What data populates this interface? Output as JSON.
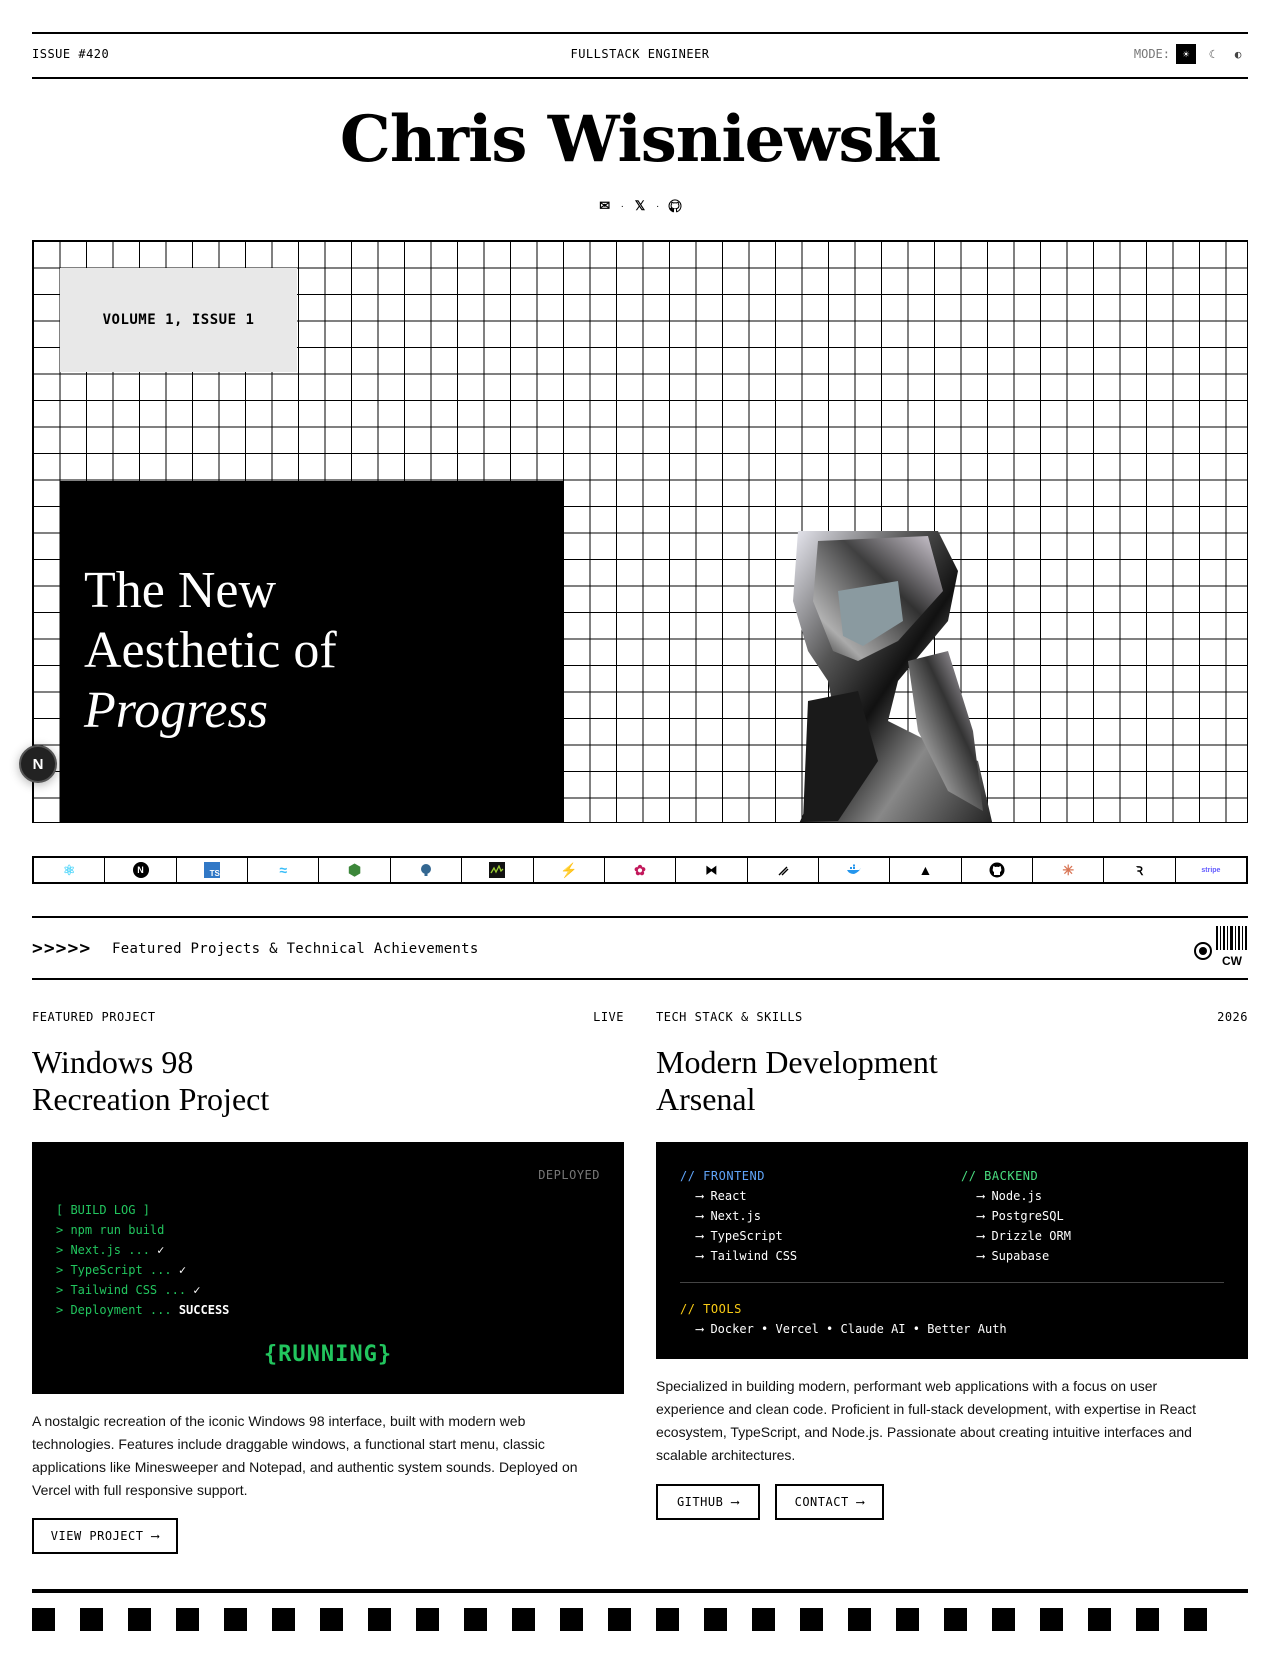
{
  "topbar": {
    "issue": "ISSUE #420",
    "role": "FULLSTACK ENGINEER",
    "mode_label": "MODE:",
    "mode_options": [
      "light",
      "dark",
      "contrast"
    ],
    "mode_active": "light"
  },
  "header": {
    "name": "Chris Wisniewski",
    "social": [
      {
        "icon": "mail-icon",
        "glyph": "✉"
      },
      {
        "icon": "x-icon",
        "glyph": "𝕏"
      },
      {
        "icon": "github-icon",
        "glyph": "⌥"
      }
    ],
    "separator": "·"
  },
  "hero": {
    "volume": "VOLUME 1, ISSUE 1",
    "headline_line1": "The New",
    "headline_line2": "Aesthetic of",
    "headline_line3": "Progress",
    "badge": "N"
  },
  "tech_strip": [
    {
      "name": "react-icon",
      "glyph": "⚛",
      "color": "#61dafb"
    },
    {
      "name": "nextjs-icon",
      "glyph": "N",
      "color": "#000000"
    },
    {
      "name": "typescript-icon",
      "glyph": "TS",
      "color": "#3178c6"
    },
    {
      "name": "tailwind-icon",
      "glyph": "≈",
      "color": "#38bdf8"
    },
    {
      "name": "nodejs-icon",
      "glyph": "⬢",
      "color": "#3c873a"
    },
    {
      "name": "postgresql-icon",
      "glyph": "🐘",
      "color": "#336791"
    },
    {
      "name": "pulse-icon",
      "glyph": "≀",
      "color": "#9acd32"
    },
    {
      "name": "supabase-icon",
      "glyph": "⚡",
      "color": "#3ecf8e"
    },
    {
      "name": "flower-icon",
      "glyph": "✿",
      "color": "#c2185b"
    },
    {
      "name": "hono-icon",
      "glyph": "⧓",
      "color": "#000000"
    },
    {
      "name": "slash-icon",
      "glyph": "⁄⁄",
      "color": "#000000"
    },
    {
      "name": "docker-icon",
      "glyph": "🐳",
      "color": "#2496ed"
    },
    {
      "name": "vercel-icon",
      "glyph": "▲",
      "color": "#000000"
    },
    {
      "name": "github-icon",
      "glyph": "◉",
      "color": "#000000"
    },
    {
      "name": "claude-icon",
      "glyph": "✳",
      "color": "#d97757"
    },
    {
      "name": "zod-icon",
      "glyph": "Ꝛ",
      "color": "#000000"
    },
    {
      "name": "stripe-icon",
      "glyph": "stripe",
      "color": "#635bff"
    }
  ],
  "section": {
    "arrows": ">>>>>",
    "subtitle": "Featured Projects & Technical Achievements",
    "barcode_label": "CW"
  },
  "left": {
    "label": "FEATURED PROJECT",
    "tag": "LIVE",
    "title_line1": "Windows 98",
    "title_line2": "Recreation Project",
    "terminal": {
      "status": "DEPLOYED",
      "log_title": "[ BUILD LOG ]",
      "lines": [
        {
          "text": "> npm run build",
          "suffix": ""
        },
        {
          "text": "> Next.js ... ",
          "suffix": "✓"
        },
        {
          "text": "> TypeScript ... ",
          "suffix": "✓"
        },
        {
          "text": "> Tailwind CSS ... ",
          "suffix": "✓"
        },
        {
          "text": "> Deployment ... ",
          "suffix": "SUCCESS"
        }
      ],
      "running": "{RUNNING}"
    },
    "description": "A nostalgic recreation of the iconic Windows 98 interface, built with modern web technologies. Features include draggable windows, a functional start menu, classic applications like Minesweeper and Notepad, and authentic system sounds. Deployed on Vercel with full responsive support.",
    "button": "VIEW PROJECT",
    "arrow": "⟶"
  },
  "right": {
    "label": "TECH STACK & SKILLS",
    "tag": "2026",
    "title_line1": "Modern Development",
    "title_line2": "Arsenal",
    "frontend_title": "// FRONTEND",
    "frontend": [
      "⟶ React",
      "⟶ Next.js",
      "⟶ TypeScript",
      "⟶ Tailwind CSS"
    ],
    "backend_title": "// BACKEND",
    "backend": [
      "⟶ Node.js",
      "⟶ PostgreSQL",
      "⟶ Drizzle ORM",
      "⟶ Supabase"
    ],
    "tools_title": "// TOOLS",
    "tools": "⟶ Docker • Vercel • Claude AI • Better Auth",
    "description": "Specialized in building modern, performant web applications with a focus on user experience and clean code. Proficient in full-stack development, with expertise in React ecosystem, TypeScript, and Node.js. Passionate about creating intuitive interfaces and scalable architectures.",
    "button_github": "GITHUB",
    "button_contact": "CONTACT",
    "arrow": "⟶"
  }
}
